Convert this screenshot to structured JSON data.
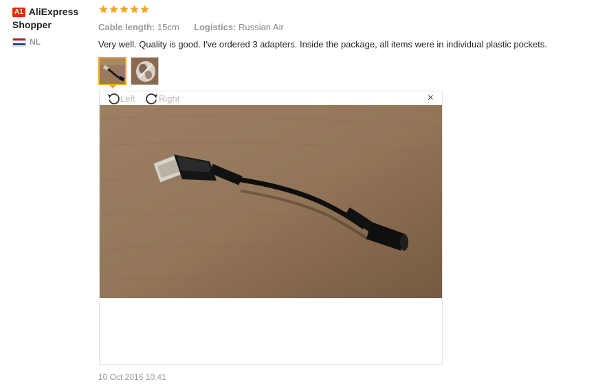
{
  "user": {
    "badge": "A1",
    "name": "AliExpress Shopper",
    "country": "NL",
    "flag_colors": [
      "#ae1c28",
      "#ffffff",
      "#21468b"
    ]
  },
  "review": {
    "rating": 5,
    "star_color": "#f6a623",
    "cable_length_label": "Cable length:",
    "cable_length_value": "15cm",
    "logistics_label": "Logistics:",
    "logistics_value": "Russian Air",
    "text": "Very well. Quality is good. I've ordered 3 adapters. Inside the package, all items were in individual plastic pockets.",
    "date": "10 Oct 2016 10:41"
  },
  "viewer": {
    "rotate_left_label": "Left",
    "rotate_right_label": "Right",
    "close_label": "×"
  },
  "photos": [
    {
      "icon": "cable-adapter-photo",
      "active": true
    },
    {
      "icon": "packaged-items-photo",
      "active": false
    }
  ]
}
